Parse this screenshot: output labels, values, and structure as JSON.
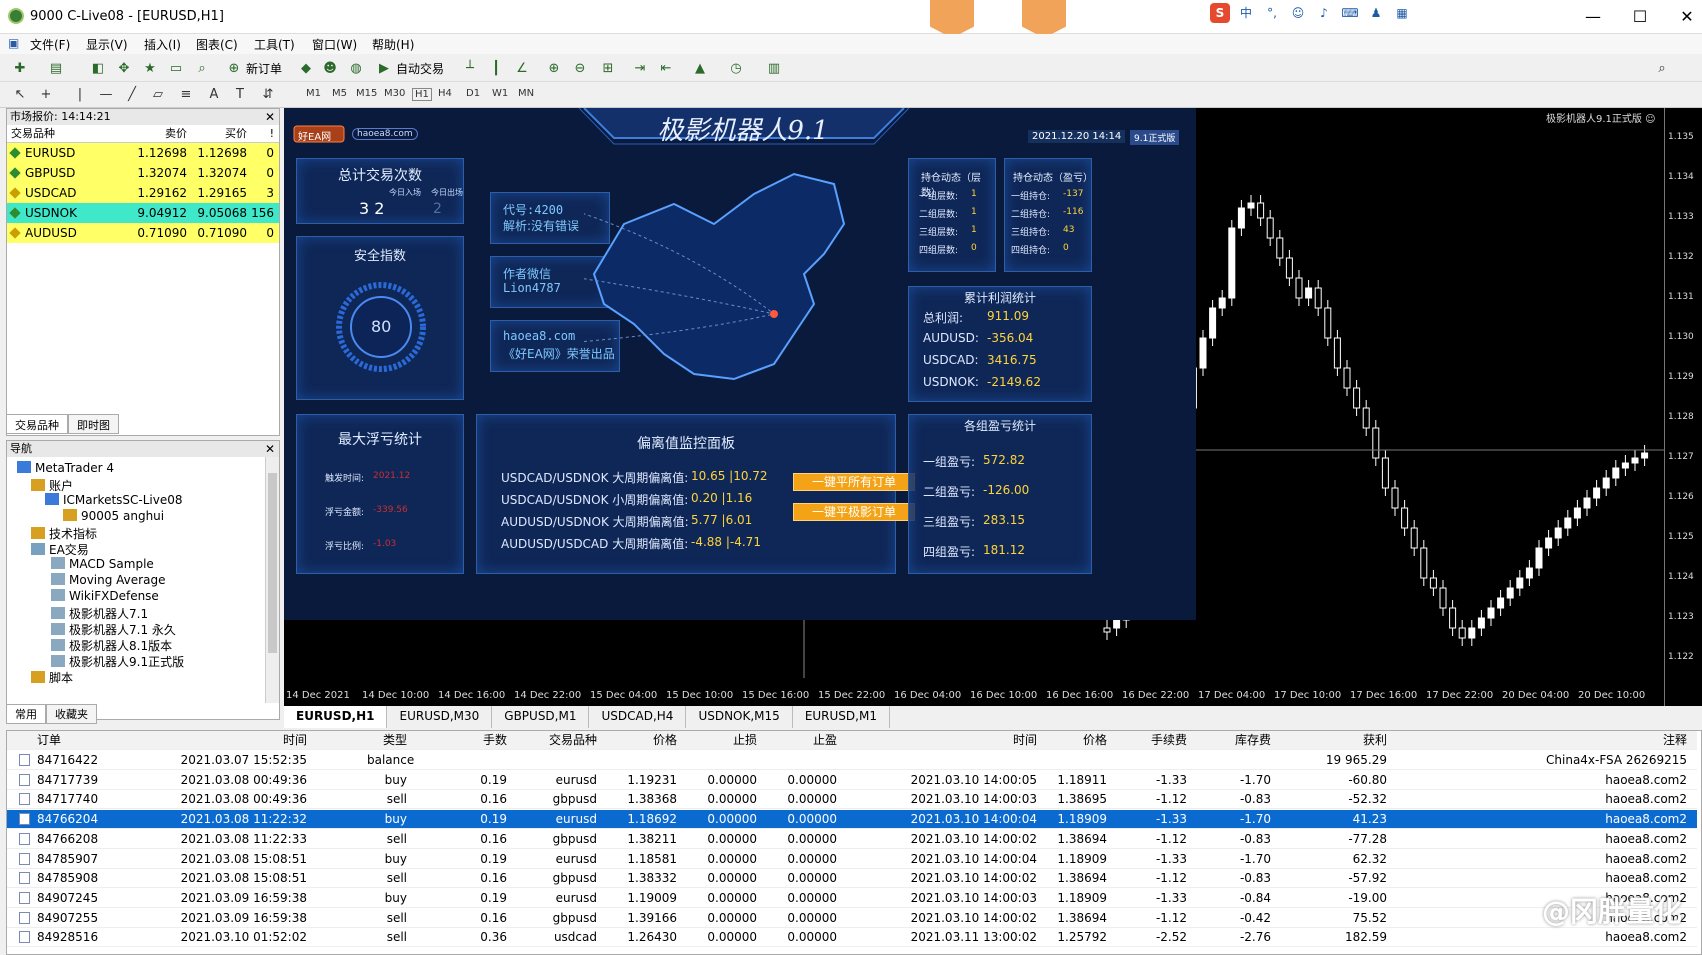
{
  "window": {
    "title": "9000          C-Live08 - [EURUSD,H1]"
  },
  "menu": [
    "文件(F)",
    "显示(V)",
    "插入(I)",
    "图表(C)",
    "工具(T)",
    "窗口(W)",
    "帮助(H)"
  ],
  "toolbar": {
    "new_order": "新订单",
    "auto_trade": "自动交易",
    "timeframes": [
      "M1",
      "M5",
      "M15",
      "M30",
      "H1",
      "H4",
      "D1",
      "W1",
      "MN"
    ]
  },
  "market_watch": {
    "header": "市场报价: 14:14:21",
    "columns": [
      "交易品种",
      "卖价",
      "买价",
      "!"
    ],
    "rows": [
      {
        "symbol": "EURUSD",
        "bid": "1.12698",
        "ask": "1.12698",
        "spread": "0",
        "bg": "#ffff66",
        "icon": "#2e8b2e"
      },
      {
        "symbol": "GBPUSD",
        "bid": "1.32074",
        "ask": "1.32074",
        "spread": "0",
        "bg": "#ffff66",
        "icon": "#2e8b2e"
      },
      {
        "symbol": "USDCAD",
        "bid": "1.29162",
        "ask": "1.29165",
        "spread": "3",
        "bg": "#ffff66",
        "icon": "#c9a000"
      },
      {
        "symbol": "USDNOK",
        "bid": "9.04912",
        "ask": "9.05068",
        "spread": "156",
        "bg": "#3fe8c8",
        "icon": "#2e8b2e"
      },
      {
        "symbol": "AUDUSD",
        "bid": "0.71090",
        "ask": "0.71090",
        "spread": "0",
        "bg": "#ffff66",
        "icon": "#c9a000"
      }
    ],
    "tabs": [
      "交易品种",
      "即时图"
    ]
  },
  "navigator": {
    "header": "导航",
    "items": [
      "MetaTrader 4",
      "账户",
      "ICMarketsSC-Live08",
      "90005          anghui",
      "技术指标",
      "EA交易",
      "MACD Sample",
      "Moving Average",
      "WikiFXDefense",
      "极影机器人7.1",
      "极影机器人7.1 永久",
      "极影机器人8.1版本",
      "极影机器人9.1正式版",
      "脚本"
    ],
    "tabs": [
      "常用",
      "收藏夹"
    ]
  },
  "dashboard": {
    "title": "极影机器人9.1",
    "brand": "好EA网",
    "site": "haoea8.com",
    "datetime": "2021.12.20 14:14",
    "version": "9.1正式版",
    "total_trades": {
      "title": "总计交易次数",
      "in_label": "今日入场",
      "out_label": "今日出场",
      "in": "3 2",
      "out": "2"
    },
    "safety": {
      "title": "安全指数",
      "value": "80"
    },
    "info": [
      {
        "l1": "代号:4200",
        "l2": "解析:没有错误"
      },
      {
        "l1": "作者微信",
        "l2": "Lion4787"
      },
      {
        "l1": "haoea8.com",
        "l2": "《好EA网》荣誉出品"
      }
    ],
    "positions_count": {
      "title": "持仓动态（层数）",
      "rows": [
        [
          "一组层数:",
          "1"
        ],
        [
          "二组层数:",
          "1"
        ],
        [
          "三组层数:",
          "1"
        ],
        [
          "四组层数:",
          "0"
        ]
      ]
    },
    "positions_pl": {
      "title": "持仓动态（盈亏）",
      "rows": [
        [
          "一组持仓:",
          "-137"
        ],
        [
          "二组持仓:",
          "-116"
        ],
        [
          "三组持仓:",
          "43"
        ],
        [
          "四组持仓:",
          "0"
        ]
      ]
    },
    "cum_profit": {
      "title": "累计利润统计",
      "rows": [
        [
          "总利润:",
          "911.09"
        ],
        [
          "AUDUSD:",
          "-356.04"
        ],
        [
          "USDCAD:",
          "3416.75"
        ],
        [
          "USDNOK:",
          "-2149.62"
        ]
      ]
    },
    "max_float": {
      "title": "最大浮亏统计",
      "rows": [
        [
          "触发时间:",
          "2021.12"
        ],
        [
          "浮亏金额:",
          "-339.56"
        ],
        [
          "浮亏比例:",
          "-1.03"
        ]
      ]
    },
    "deviation": {
      "title": "偏离值监控面板",
      "rows": [
        [
          "USDCAD/USDNOK 大周期偏离值:",
          "10.65 |10.72"
        ],
        [
          "USDCAD/USDNOK 小周期偏离值:",
          "0.20 |1.16"
        ],
        [
          "AUDUSD/USDNOK 大周期偏离值:",
          "5.77 |6.01"
        ],
        [
          "AUDUSD/USDCAD 大周期偏离值:",
          "-4.88 |-4.71"
        ]
      ],
      "btn1": "一键平所有订单",
      "btn2": "一键平极影订单"
    },
    "group_pl": {
      "title": "各组盈亏统计",
      "rows": [
        [
          "一组盈亏:",
          "572.82"
        ],
        [
          "二组盈亏:",
          "-126.00"
        ],
        [
          "三组盈亏:",
          "283.15"
        ],
        [
          "四组盈亏:",
          "181.12"
        ]
      ]
    }
  },
  "chart": {
    "ea_label": "极影机器人9.1正式版 ☺",
    "time_labels": [
      "14 Dec 2021",
      "14 Dec 10:00",
      "14 Dec 16:00",
      "14 Dec 22:00",
      "15 Dec 04:00",
      "15 Dec 10:00",
      "15 Dec 16:00",
      "15 Dec 22:00",
      "16 Dec 04:00",
      "16 Dec 10:00",
      "16 Dec 16:00",
      "16 Dec 22:00",
      "17 Dec 04:00",
      "17 Dec 10:00",
      "17 Dec 16:00",
      "17 Dec 22:00",
      "20 Dec 04:00",
      "20 Dec 10:00"
    ],
    "price_labels": [
      "1.135",
      "1.134",
      "1.133",
      "1.132",
      "1.131",
      "1.130",
      "1.129",
      "1.128",
      "1.127",
      "1.126",
      "1.125",
      "1.124",
      "1.123",
      "1.122"
    ],
    "tabs": [
      "EURUSD,H1",
      "EURUSD,M30",
      "GBPUSD,M1",
      "USDCAD,H4",
      "USDNOK,M15",
      "EURUSD,M1"
    ]
  },
  "terminal": {
    "columns": [
      "订单",
      "时间",
      "类型",
      "手数",
      "交易品种",
      "价格",
      "止损",
      "止盈",
      "时间",
      "价格",
      "手续费",
      "库存费",
      "获利",
      "注释"
    ],
    "rows": [
      [
        "84716422",
        "2021.03.07 15:52:35",
        "balance",
        "",
        "",
        "",
        "",
        "",
        "",
        "",
        "",
        "",
        "19 965.29",
        "China4x-FSA 26269215"
      ],
      [
        "84717739",
        "2021.03.08 00:49:36",
        "buy",
        "0.19",
        "eurusd",
        "1.19231",
        "0.00000",
        "0.00000",
        "2021.03.10 14:00:05",
        "1.18911",
        "-1.33",
        "-1.70",
        "-60.80",
        "haoea8.com2"
      ],
      [
        "84717740",
        "2021.03.08 00:49:36",
        "sell",
        "0.16",
        "gbpusd",
        "1.38368",
        "0.00000",
        "0.00000",
        "2021.03.10 14:00:03",
        "1.38695",
        "-1.12",
        "-0.83",
        "-52.32",
        "haoea8.com2"
      ],
      [
        "84766204",
        "2021.03.08 11:22:32",
        "buy",
        "0.19",
        "eurusd",
        "1.18692",
        "0.00000",
        "0.00000",
        "2021.03.10 14:00:04",
        "1.18909",
        "-1.33",
        "-1.70",
        "41.23",
        "haoea8.com2"
      ],
      [
        "84766208",
        "2021.03.08 11:22:33",
        "sell",
        "0.16",
        "gbpusd",
        "1.38211",
        "0.00000",
        "0.00000",
        "2021.03.10 14:00:02",
        "1.38694",
        "-1.12",
        "-0.83",
        "-77.28",
        "haoea8.com2"
      ],
      [
        "84785907",
        "2021.03.08 15:08:51",
        "buy",
        "0.19",
        "eurusd",
        "1.18581",
        "0.00000",
        "0.00000",
        "2021.03.10 14:00:04",
        "1.18909",
        "-1.33",
        "-1.70",
        "62.32",
        "haoea8.com2"
      ],
      [
        "84785908",
        "2021.03.08 15:08:51",
        "sell",
        "0.16",
        "gbpusd",
        "1.38332",
        "0.00000",
        "0.00000",
        "2021.03.10 14:00:02",
        "1.38694",
        "-1.12",
        "-0.83",
        "-57.92",
        "haoea8.com2"
      ],
      [
        "84907245",
        "2021.03.09 16:59:38",
        "buy",
        "0.19",
        "eurusd",
        "1.19009",
        "0.00000",
        "0.00000",
        "2021.03.10 14:00:03",
        "1.18909",
        "-1.33",
        "-0.84",
        "-19.00",
        "haoea8.com2"
      ],
      [
        "84907255",
        "2021.03.09 16:59:38",
        "sell",
        "0.16",
        "gbpusd",
        "1.39166",
        "0.00000",
        "0.00000",
        "2021.03.10 14:00:02",
        "1.38694",
        "-1.12",
        "-0.42",
        "75.52",
        "haoea8.com2"
      ],
      [
        "84928516",
        "2021.03.10 01:52:02",
        "sell",
        "0.36",
        "usdcad",
        "1.26430",
        "0.00000",
        "0.00000",
        "2021.03.11 13:00:02",
        "1.25792",
        "-2.52",
        "-2.76",
        "182.59",
        "haoea8.com2"
      ]
    ],
    "selected_row": 3
  },
  "watermark": "@冈胖量化"
}
